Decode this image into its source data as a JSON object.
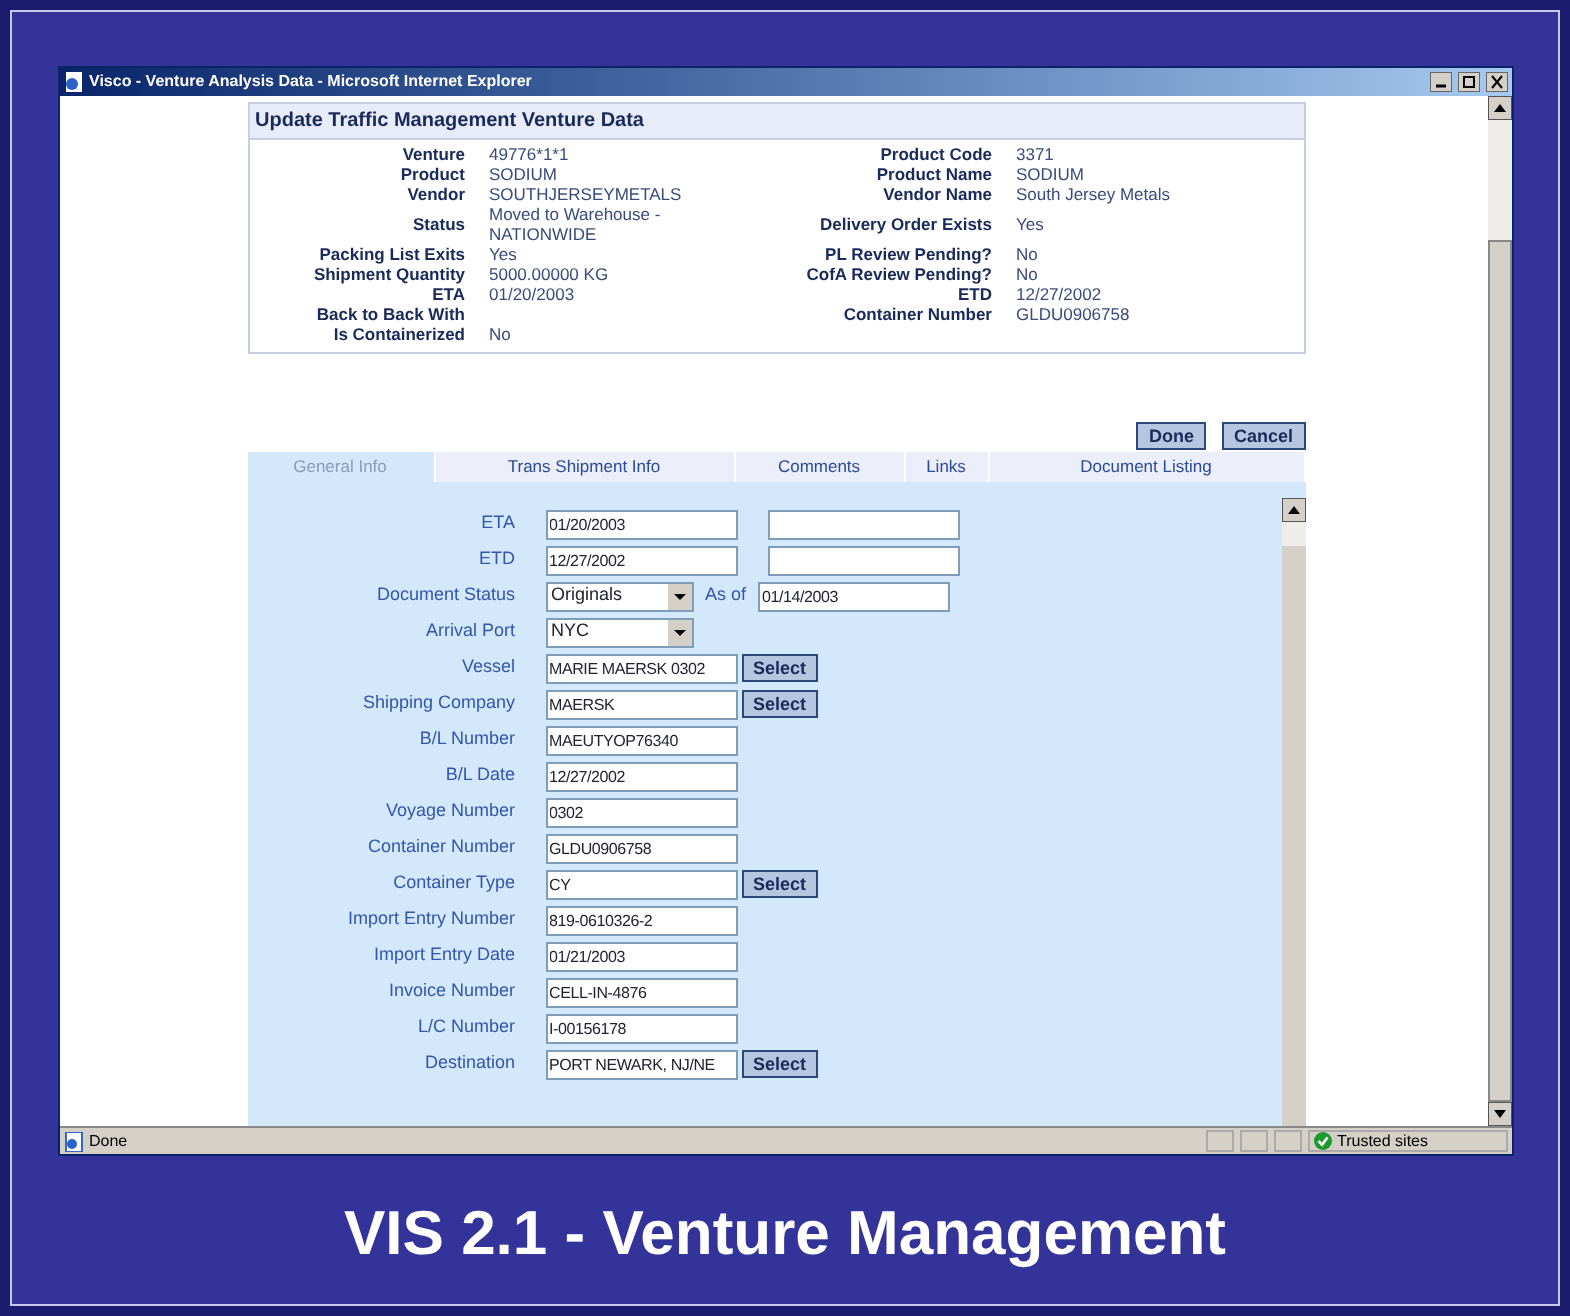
{
  "window": {
    "title": "Visco - Venture Analysis Data - Microsoft Internet Explorer"
  },
  "summary": {
    "title": "Update Traffic Management Venture Data",
    "rows": [
      [
        {
          "label": "Venture",
          "value": "49776*1*1"
        },
        {
          "label": "Product Code",
          "value": "3371"
        }
      ],
      [
        {
          "label": "Product",
          "value": "SODIUM"
        },
        {
          "label": "Product Name",
          "value": "SODIUM"
        }
      ],
      [
        {
          "label": "Vendor",
          "value": "SOUTHJERSEYMETALS"
        },
        {
          "label": "Vendor Name",
          "value": "South Jersey Metals"
        }
      ],
      [
        {
          "label": "Status",
          "value": "Moved to Warehouse - NATIONWIDE"
        },
        {
          "label": "Delivery Order Exists",
          "value": "Yes"
        }
      ],
      [
        {
          "label": "Packing List Exits",
          "value": "Yes"
        },
        {
          "label": "PL Review Pending?",
          "value": "No"
        }
      ],
      [
        {
          "label": "Shipment Quantity",
          "value": "5000.00000 KG"
        },
        {
          "label": "CofA Review Pending?",
          "value": "No"
        }
      ],
      [
        {
          "label": "ETA",
          "value": "01/20/2003"
        },
        {
          "label": "ETD",
          "value": "12/27/2002"
        }
      ],
      [
        {
          "label": "Back to Back With"
        },
        {
          "label": "Container Number",
          "value": "GLDU0906758"
        }
      ],
      [
        {
          "label": "Is Containerized",
          "value": "No"
        }
      ]
    ]
  },
  "actions": [
    "Done",
    "Cancel"
  ],
  "tabs": [
    {
      "label": "General Info",
      "selected": true
    },
    {
      "label": "Trans Shipment Info",
      "selected": false
    },
    {
      "label": "Comments",
      "selected": false
    },
    {
      "label": "Links",
      "selected": false
    },
    {
      "label": "Document Listing",
      "selected": false
    }
  ],
  "form": {
    "fields": [
      {
        "kind": "pair",
        "label": "ETA",
        "value": "01/20/2003"
      },
      {
        "kind": "pair",
        "label": "ETD",
        "value": "12/27/2002"
      },
      {
        "kind": "select",
        "label": "Document Status",
        "value": "Originals",
        "as_of": {
          "label": "As of",
          "value": "01/14/2003"
        }
      },
      {
        "kind": "select",
        "label": "Arrival Port",
        "value": "NYC"
      },
      {
        "kind": "text",
        "label": "Vessel",
        "value": "MARIE MAERSK 0302",
        "button": "Select"
      },
      {
        "kind": "text",
        "label": "Shipping Company",
        "value": "MAERSK",
        "button": "Select"
      },
      {
        "kind": "text",
        "label": "B/L Number",
        "value": "MAEUTYOP76340"
      },
      {
        "kind": "text",
        "label": "B/L Date",
        "value": "12/27/2002"
      },
      {
        "kind": "text",
        "label": "Voyage Number",
        "value": "0302"
      },
      {
        "kind": "text",
        "label": "Container Number",
        "value": "GLDU0906758"
      },
      {
        "kind": "text",
        "label": "Container Type",
        "value": "CY",
        "button": "Select"
      },
      {
        "kind": "text",
        "label": "Import Entry Number",
        "value": "819-0610326-2"
      },
      {
        "kind": "text",
        "label": "Import Entry Date",
        "value": "01/21/2003"
      },
      {
        "kind": "text",
        "label": "Invoice Number",
        "value": "CELL-IN-4876"
      },
      {
        "kind": "text",
        "label": "L/C Number",
        "value": "I-00156178"
      },
      {
        "kind": "text",
        "label": "Destination",
        "value": "PORT NEWARK, NJ/NE",
        "button": "Select"
      }
    ]
  },
  "status_bar": {
    "text": "Done",
    "zone": "Trusted sites"
  },
  "slide_title": "VIS 2.1 - Venture Management"
}
